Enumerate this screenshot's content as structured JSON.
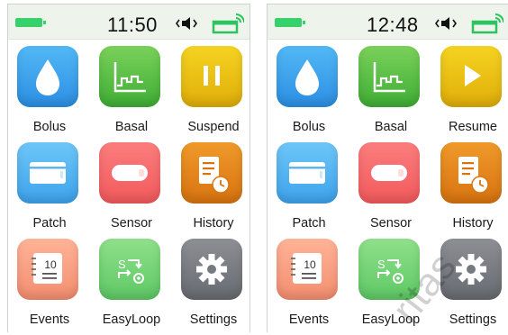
{
  "screens": [
    {
      "time": "11:50",
      "apps": [
        {
          "label": "Bolus",
          "icon": "drop-icon"
        },
        {
          "label": "Basal",
          "icon": "basal-graph-icon"
        },
        {
          "label": "Suspend",
          "icon": "pause-icon"
        },
        {
          "label": "Patch",
          "icon": "patch-icon"
        },
        {
          "label": "Sensor",
          "icon": "sensor-icon"
        },
        {
          "label": "History",
          "icon": "history-icon"
        },
        {
          "label": "Events",
          "icon": "events-calendar-icon",
          "calendar_number": "10"
        },
        {
          "label": "EasyLoop",
          "icon": "easyloop-icon"
        },
        {
          "label": "Settings",
          "icon": "gear-icon"
        }
      ]
    },
    {
      "time": "12:48",
      "apps": [
        {
          "label": "Bolus",
          "icon": "drop-icon"
        },
        {
          "label": "Basal",
          "icon": "basal-graph-icon"
        },
        {
          "label": "Resume",
          "icon": "play-icon"
        },
        {
          "label": "Patch",
          "icon": "patch-icon"
        },
        {
          "label": "Sensor",
          "icon": "sensor-icon"
        },
        {
          "label": "History",
          "icon": "history-icon"
        },
        {
          "label": "Events",
          "icon": "events-calendar-icon",
          "calendar_number": "10"
        },
        {
          "label": "EasyLoop",
          "icon": "easyloop-icon"
        },
        {
          "label": "Settings",
          "icon": "gear-icon"
        }
      ]
    }
  ],
  "status_icons": [
    "battery-icon",
    "sound-muted-icon",
    "signal-icon"
  ],
  "colors": {
    "battery": "#37d16c",
    "statusbar_bg": "#eef3ec",
    "bolus": "#2c8fe4",
    "basal": "#3fae35",
    "suspend": "#e0ae0a",
    "patch": "#3da3ec",
    "sensor": "#f25a5c",
    "history": "#d87310",
    "events": "#f38e70",
    "easyloop": "#5ec865",
    "settings": "#676a70"
  }
}
